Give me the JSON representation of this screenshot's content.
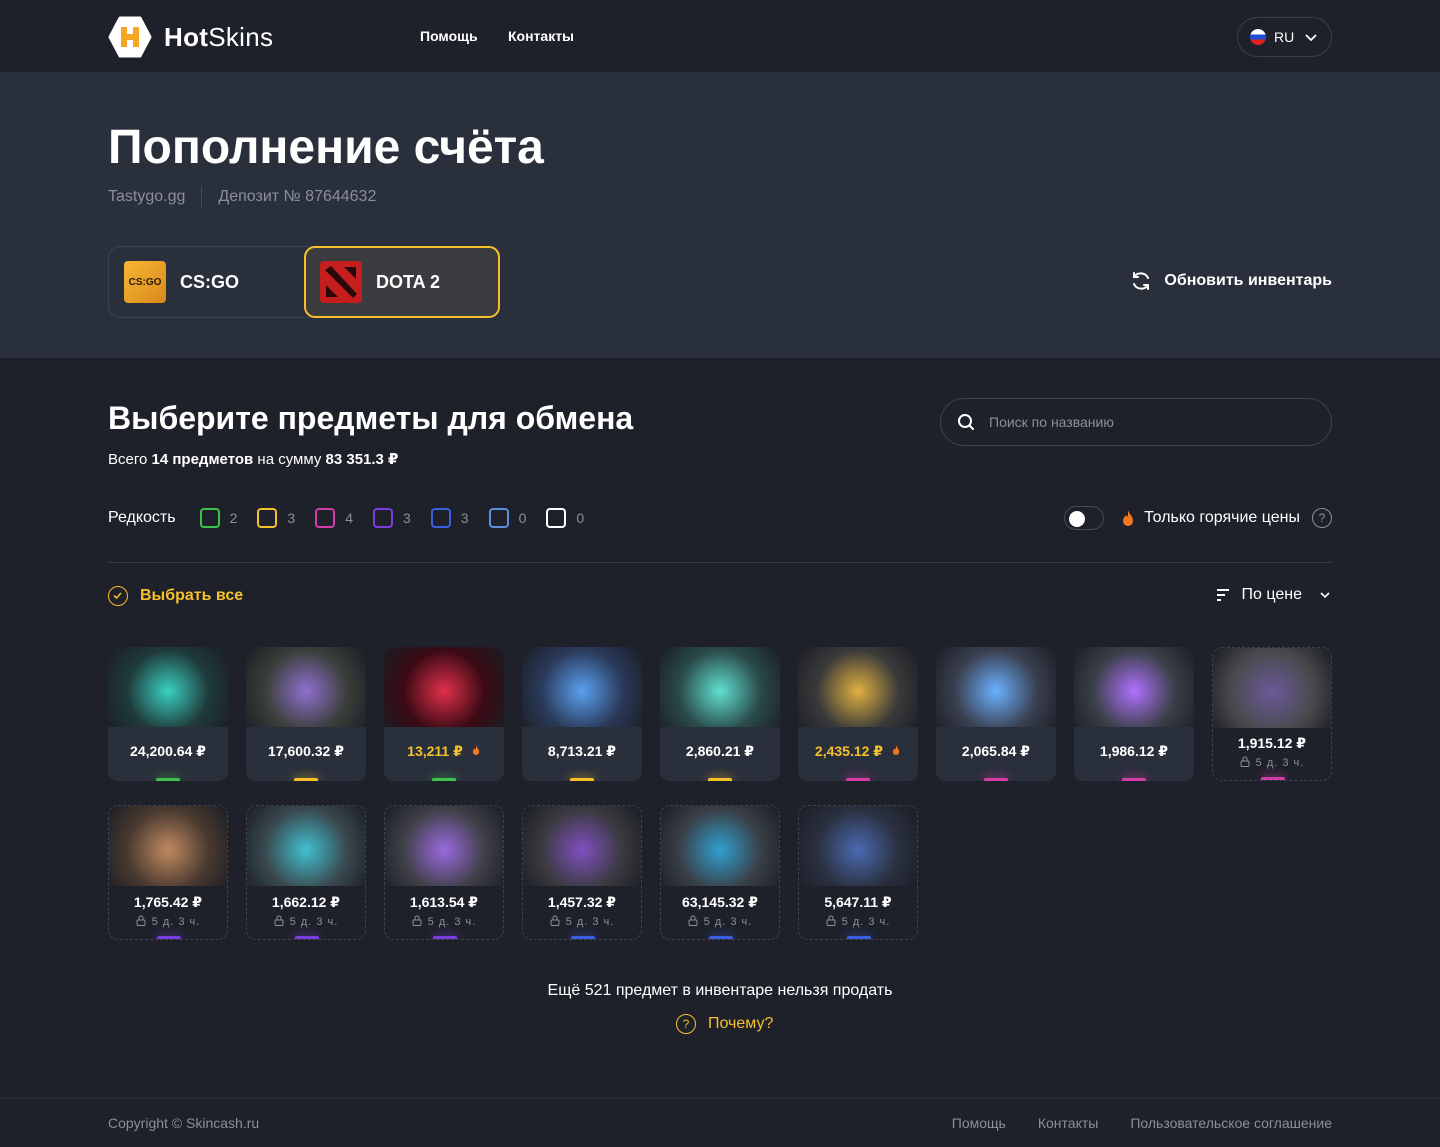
{
  "header": {
    "logo_bold": "Hot",
    "logo_light": "Skins",
    "nav": [
      "Помощь",
      "Контакты"
    ],
    "lang": "RU"
  },
  "hero": {
    "title": "Пополнение счёта",
    "site": "Tastygo.gg",
    "deposit": "Депозит № 87644632",
    "games": [
      {
        "label": "CS:GO",
        "icon": "csgo-icon",
        "icon_text": "CS:GO"
      },
      {
        "label": "DOTA 2",
        "icon": "dota-icon"
      }
    ],
    "active_game": "DOTA 2",
    "refresh_label": "Обновить инвентарь"
  },
  "section": {
    "title": "Выберите предметы для обмена",
    "summary_prefix": "Всего",
    "summary_count": "14 предметов",
    "summary_mid": "на сумму",
    "summary_total": "83 351.3 ₽",
    "search_placeholder": "Поиск по названию"
  },
  "rarity": {
    "label": "Редкость",
    "filters": [
      {
        "color": "#3ec24a",
        "count": "2"
      },
      {
        "color": "#f5c02a",
        "count": "3"
      },
      {
        "color": "#d43ca8",
        "count": "4"
      },
      {
        "color": "#7a3ee0",
        "count": "3"
      },
      {
        "color": "#3a5fe0",
        "count": "3"
      },
      {
        "color": "#5b8fe0",
        "count": "0"
      },
      {
        "color": "#ffffff",
        "count": "0"
      }
    ]
  },
  "hot_filter": {
    "label": "Только горячие цены",
    "enabled": false,
    "help": "?"
  },
  "select_all": "Выбрать все",
  "sort_label": "По цене",
  "items": [
    {
      "price": "24,200.64 ₽",
      "hot": false,
      "locked": false,
      "rarity_color": "#3ec24a",
      "art": [
        "#1f3a3a",
        "#3ad0c0"
      ]
    },
    {
      "price": "17,600.32 ₽",
      "hot": false,
      "locked": false,
      "rarity_color": "#f5c02a",
      "art": [
        "#3a3f3a",
        "#9070d0"
      ]
    },
    {
      "price": "13,211 ₽",
      "hot": true,
      "locked": false,
      "rarity_color": "#3ec24a",
      "art": [
        "#3a0a14",
        "#e0304a"
      ]
    },
    {
      "price": "8,713.21 ₽",
      "hot": false,
      "locked": false,
      "rarity_color": "#f5c02a",
      "art": [
        "#2a3a5a",
        "#5aa0f0"
      ]
    },
    {
      "price": "2,860.21 ₽",
      "hot": false,
      "locked": false,
      "rarity_color": "#f5c02a",
      "art": [
        "#2a4a4a",
        "#60e0d0"
      ]
    },
    {
      "price": "2,435.12 ₽",
      "hot": true,
      "locked": false,
      "rarity_color": "#d43ca8",
      "art": [
        "#3a3a3a",
        "#e0b040"
      ]
    },
    {
      "price": "2,065.84 ₽",
      "hot": false,
      "locked": false,
      "rarity_color": "#d43ca8",
      "art": [
        "#3a4050",
        "#6ab0ff"
      ]
    },
    {
      "price": "1,986.12 ₽",
      "hot": false,
      "locked": false,
      "rarity_color": "#d43ca8",
      "art": [
        "#3a4048",
        "#b070ff"
      ]
    },
    {
      "price": "1,915.12 ₽",
      "hot": false,
      "locked": true,
      "lock_text": "5 д. 3 ч.",
      "rarity_color": "#d43ca8",
      "art": [
        "#4a4a4e",
        "#6a5a9a"
      ]
    },
    {
      "price": "1,765.42 ₽",
      "hot": false,
      "locked": true,
      "lock_text": "5 д. 3 ч.",
      "rarity_color": "#7a3ee0",
      "art": [
        "#4a3a30",
        "#c08a60"
      ]
    },
    {
      "price": "1,662.12 ₽",
      "hot": false,
      "locked": true,
      "lock_text": "5 д. 3 ч.",
      "rarity_color": "#7a3ee0",
      "art": [
        "#3a4a50",
        "#40c0d0"
      ]
    },
    {
      "price": "1,613.54 ₽",
      "hot": false,
      "locked": true,
      "lock_text": "5 д. 3 ч.",
      "rarity_color": "#7a3ee0",
      "art": [
        "#404048",
        "#9a6ae0"
      ]
    },
    {
      "price": "1,457.32 ₽",
      "hot": false,
      "locked": true,
      "lock_text": "5 д. 3 ч.",
      "rarity_color": "#3a5fe0",
      "art": [
        "#3a3a40",
        "#8050c0"
      ]
    },
    {
      "price": "63,145.32 ₽",
      "hot": false,
      "locked": true,
      "lock_text": "5 д. 3 ч.",
      "rarity_color": "#3a5fe0",
      "art": [
        "#3a4048",
        "#30a0d0"
      ]
    },
    {
      "price": "5,647.11 ₽",
      "hot": false,
      "locked": true,
      "lock_text": "5 д. 3 ч.",
      "rarity_color": "#3a5fe0",
      "art": [
        "#2a3040",
        "#4a6ab0"
      ]
    }
  ],
  "more_text": "Ещё 521 предмет в инвентаре нельзя продать",
  "why_label": "Почему?",
  "footer": {
    "copyright": "Copyright © Skincash.ru",
    "links": [
      "Помощь",
      "Контакты",
      "Пользовательское соглашение"
    ]
  },
  "colors": {
    "accent": "#f5c02a",
    "bg": "#1e212a",
    "hero_bg": "#2a2f3c"
  }
}
